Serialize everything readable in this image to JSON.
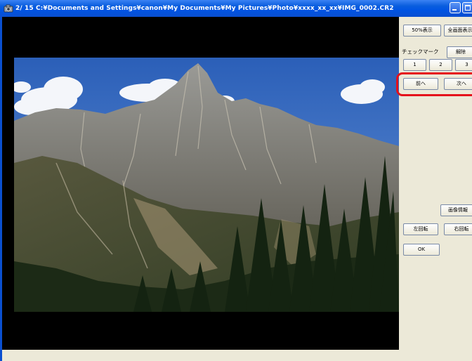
{
  "window": {
    "title": "2/ 15  C:¥Documents and Settings¥canon¥My Documents¥My Pictures¥Photo¥xxxx_xx_xx¥IMG_0002.CR2"
  },
  "panel": {
    "view_50_label": "50%表示",
    "view_full_label": "全画面表示",
    "checkmark_label": "チェックマーク",
    "clear_label": "解除",
    "check_buttons": [
      "1",
      "2",
      "3"
    ],
    "prev_label": "前へ",
    "next_label": "次へ",
    "image_info_label": "画像情報",
    "rotate_left_label": "左回転",
    "rotate_right_label": "右回転",
    "ok_label": "OK"
  },
  "colors": {
    "highlight": "#e5111b",
    "titlebar": "#0054e3"
  }
}
